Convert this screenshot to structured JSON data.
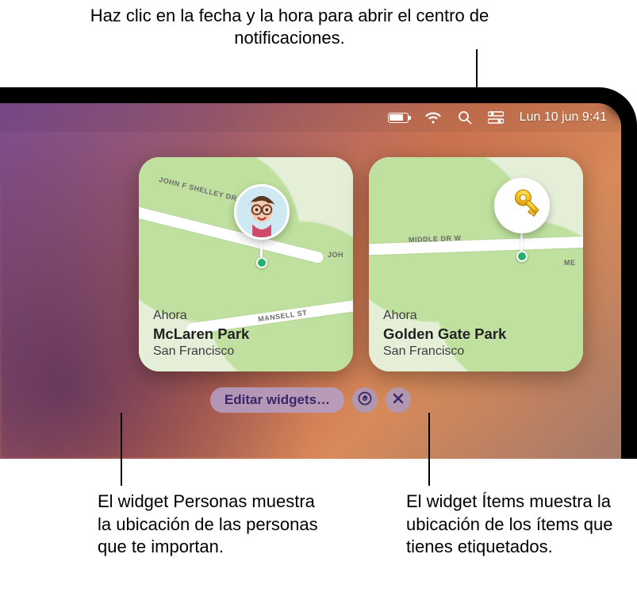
{
  "callouts": {
    "top": "Haz clic en la fecha y la hora para abrir el centro de notificaciones.",
    "bottom_left": "El widget Personas muestra la ubicación de las personas que te importan.",
    "bottom_right": "El widget Ítems muestra la ubicación de los ítems que tienes etiquetados."
  },
  "menubar": {
    "datetime": "Lun 10 jun  9:41",
    "icons": {
      "battery": "battery-icon",
      "wifi": "wifi-icon",
      "search": "search-icon",
      "control_center": "control-center-icon"
    }
  },
  "widgets": {
    "person": {
      "now": "Ahora",
      "place": "McLaren Park",
      "city": "San Francisco",
      "roads": [
        "JOHN F SHELLEY DR",
        "JOH",
        "MANSELL ST"
      ],
      "avatar_name": "memoji-avatar"
    },
    "item": {
      "now": "Ahora",
      "place": "Golden Gate Park",
      "city": "San Francisco",
      "roads": [
        "MIDDLE DR W",
        "ME"
      ],
      "icon_name": "keys-icon"
    }
  },
  "controls": {
    "edit_label": "Editar widgets…",
    "settings_icon": "gear-icon",
    "close_icon": "close-icon"
  }
}
